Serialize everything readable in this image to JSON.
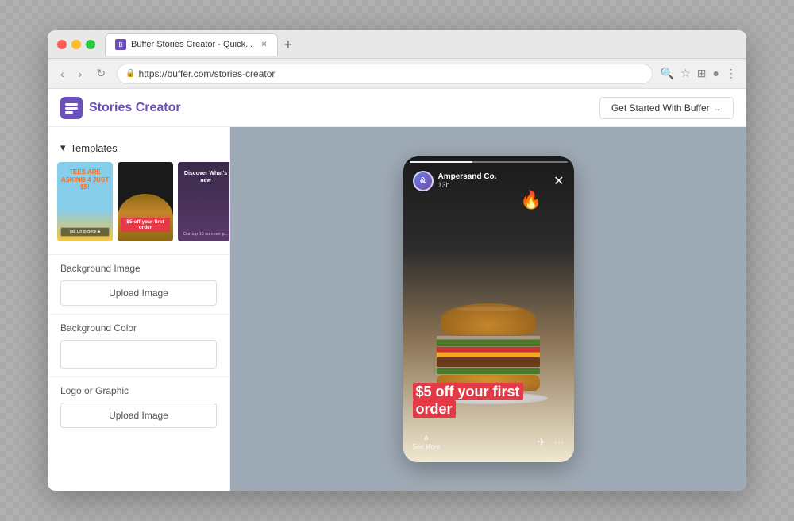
{
  "browser": {
    "tab_title": "Buffer Stories Creator - Quick...",
    "url": "https://buffer.com/stories-creator",
    "nav_back": "‹",
    "nav_forward": "›",
    "nav_reload": "↻"
  },
  "app": {
    "logo_brand": "Stories",
    "logo_suffix": " Creator",
    "cta_button": "Get Started With Buffer →"
  },
  "sidebar": {
    "templates_label": "Templates",
    "templates": [
      {
        "label": "Tees Are Asking 4 Just $5!",
        "type": "beach"
      },
      {
        "label": "$5 off your first order",
        "type": "burger"
      },
      {
        "label": "Discover What's New",
        "type": "woman"
      }
    ],
    "bg_image_label": "Background Image",
    "upload_image_label": "Upload Image",
    "bg_color_label": "Background Color",
    "logo_graphic_label": "Logo or Graphic",
    "upload_logo_label": "Upload Image"
  },
  "story_preview": {
    "avatar_text": "&",
    "username": "Ampersand Co.",
    "time": "13h",
    "cta_line1": "$5 off your first",
    "cta_line2": "order",
    "see_more": "See More",
    "fire_emoji": "🔥",
    "close_icon": "✕"
  },
  "icons": {
    "chevron_down": "▾",
    "send": "✈",
    "more": "···",
    "chevron_up": "^",
    "star": "☆",
    "menu": "≡",
    "profile": "●",
    "lock": "🔒"
  }
}
